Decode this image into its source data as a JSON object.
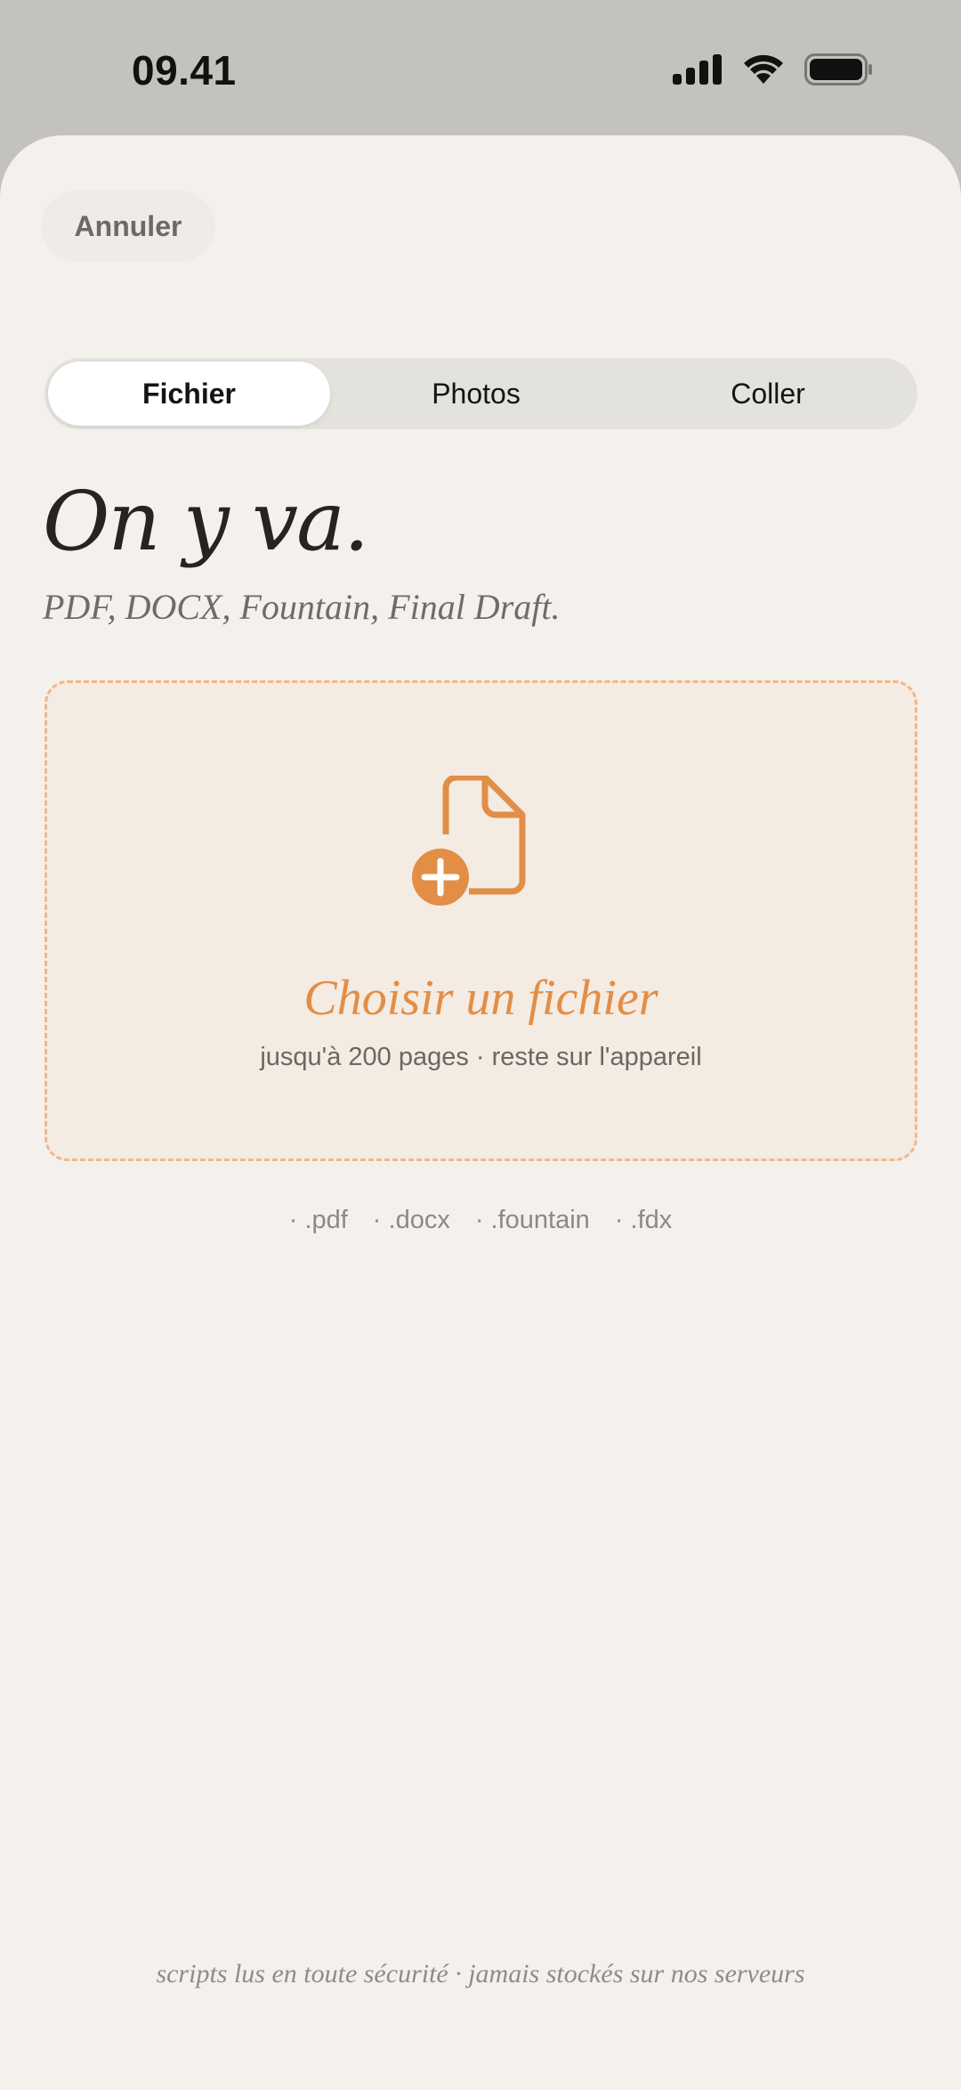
{
  "status_bar": {
    "time": "09.41",
    "icons": [
      "cellular-signal-icon",
      "wifi-icon",
      "battery-icon"
    ]
  },
  "header": {
    "cancel_label": "Annuler"
  },
  "tabs": [
    {
      "label": "Fichier",
      "active": true
    },
    {
      "label": "Photos",
      "active": false
    },
    {
      "label": "Coller",
      "active": false
    }
  ],
  "main": {
    "title": "On y va.",
    "subtitle": "PDF, DOCX, Fountain, Final Draft."
  },
  "dropzone": {
    "icon": "file-add-icon",
    "title": "Choisir un fichier",
    "subtitle": "jusqu'à 200 pages · reste sur l'appareil"
  },
  "formats": [
    "· .pdf",
    "· .docx",
    "· .fountain",
    "· .fdx"
  ],
  "footer": {
    "note": "scripts lus en toute sécurité · jamais stockés sur nos serveurs"
  },
  "colors": {
    "accent": "#e28e46",
    "dashed_border": "#efb78a",
    "sheet_bg": "#f4f1ec",
    "dropzone_bg": "#f4ebe3"
  }
}
